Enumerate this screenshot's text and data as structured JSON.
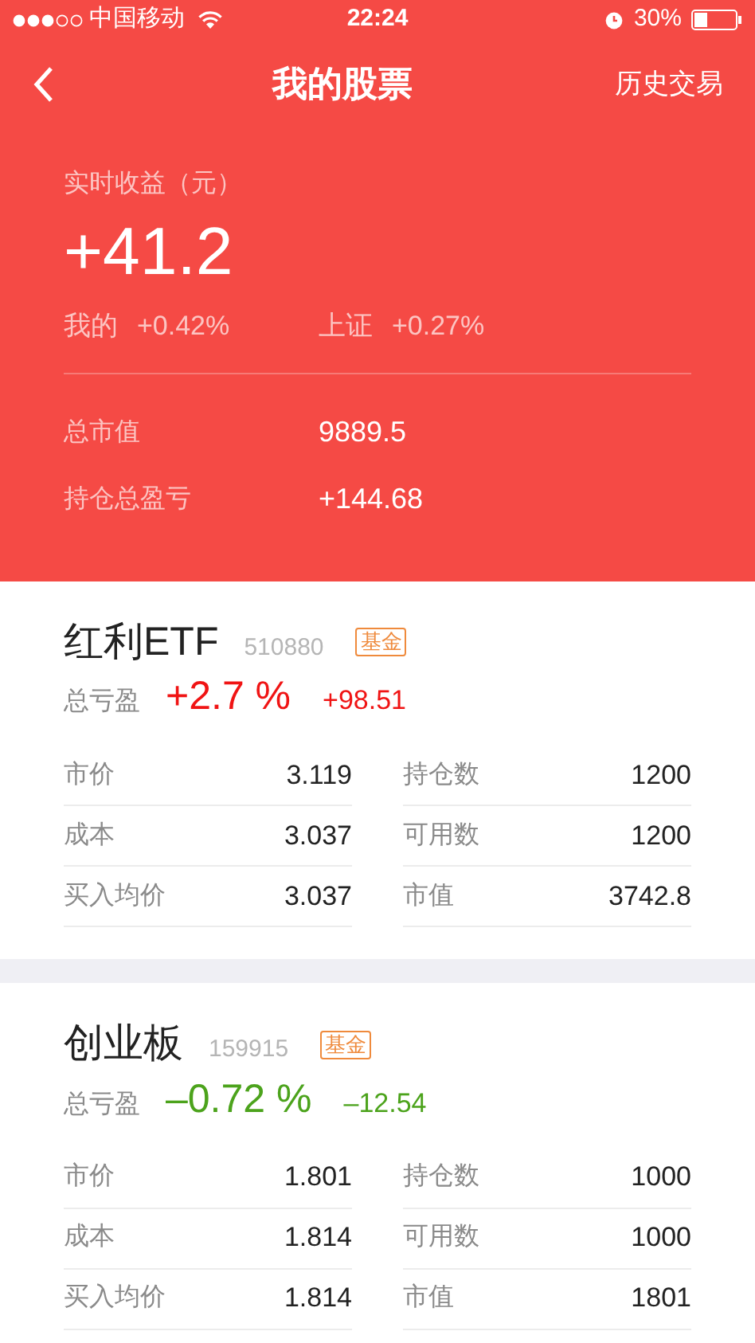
{
  "status_bar": {
    "carrier": "中国移动",
    "time": "22:24",
    "battery": "30%"
  },
  "nav": {
    "title": "我的股票",
    "action": "历史交易"
  },
  "summary": {
    "label": "实时收益（元）",
    "value": "+41.2",
    "compare": [
      {
        "label": "我的",
        "value": "+0.42%"
      },
      {
        "label": "上证",
        "value": "+0.27%"
      }
    ],
    "rows": [
      {
        "label": "总市值",
        "value": "9889.5"
      },
      {
        "label": "持仓总盈亏",
        "value": "+144.68"
      }
    ]
  },
  "holdings": [
    {
      "name": "红利ETF",
      "code": "510880",
      "tag": "基金",
      "profit_label": "总亏盈",
      "percent": "+2.7 %",
      "amount": "+98.51",
      "negative": false,
      "stats": [
        {
          "label": "市价",
          "value": "3.119"
        },
        {
          "label": "持仓数",
          "value": "1200"
        },
        {
          "label": "成本",
          "value": "3.037"
        },
        {
          "label": "可用数",
          "value": "1200"
        },
        {
          "label": "买入均价",
          "value": "3.037"
        },
        {
          "label": "市值",
          "value": "3742.8"
        }
      ]
    },
    {
      "name": "创业板",
      "code": "159915",
      "tag": "基金",
      "profit_label": "总亏盈",
      "percent": "–0.72 %",
      "amount": "–12.54",
      "negative": true,
      "stats": [
        {
          "label": "市价",
          "value": "1.801"
        },
        {
          "label": "持仓数",
          "value": "1000"
        },
        {
          "label": "成本",
          "value": "1.814"
        },
        {
          "label": "可用数",
          "value": "1000"
        },
        {
          "label": "买入均价",
          "value": "1.814"
        },
        {
          "label": "市值",
          "value": "1801"
        }
      ]
    }
  ]
}
